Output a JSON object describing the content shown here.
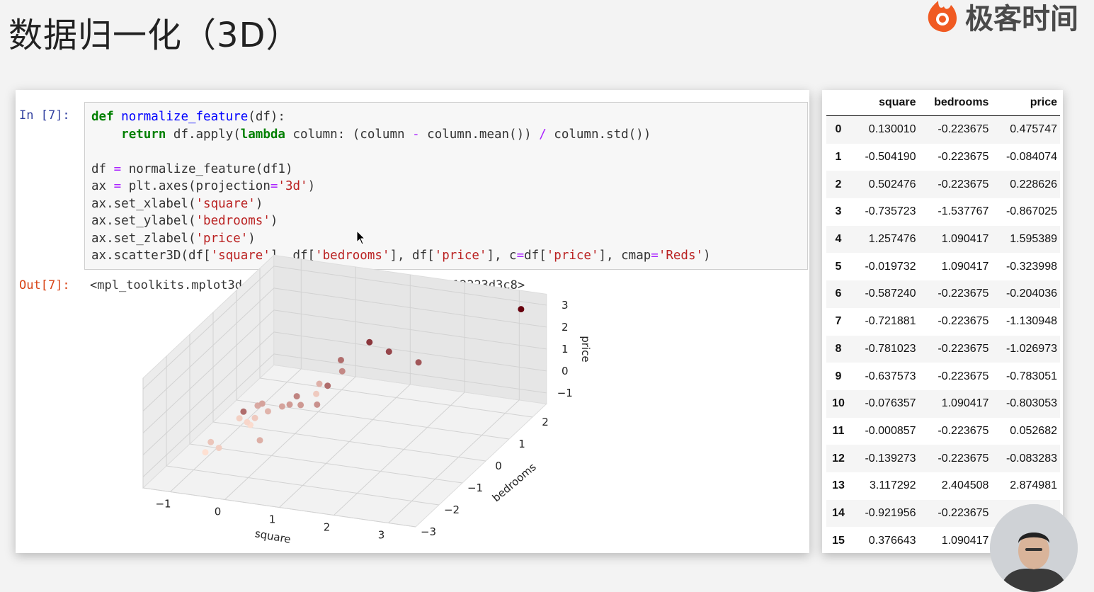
{
  "slide": {
    "title": "数据归一化（3D）",
    "brand": "极客时间",
    "brand_color": "#f05a22"
  },
  "notebook": {
    "in_prompt": "In [7]:",
    "out_prompt": "Out[7]:",
    "code_lines": [
      "def normalize_feature(df):",
      "    return df.apply(lambda column: (column - column.mean()) / column.std())",
      "",
      "df = normalize_feature(df1)",
      "ax = plt.axes(projection='3d')",
      "ax.set_xlabel('square')",
      "ax.set_ylabel('bedrooms')",
      "ax.set_zlabel('price')",
      "ax.scatter3D(df['square'], df['bedrooms'], df['price'], c=df['price'], cmap='Reds')"
    ],
    "output_text": "<mpl_toolkits.mplot3d.art3d.Path3DCollection at 0x12323d3c8>"
  },
  "chart_data": {
    "type": "scatter",
    "projection": "3d",
    "title": "",
    "xlabel": "square",
    "ylabel": "bedrooms",
    "zlabel": "price",
    "xticks": [
      "−1",
      "0",
      "1",
      "2",
      "3"
    ],
    "yticks": [
      "−3",
      "−2",
      "−1",
      "0",
      "1",
      "2"
    ],
    "zticks": [
      "−1",
      "0",
      "1",
      "2",
      "3"
    ],
    "xlim": [
      -1.5,
      3.5
    ],
    "ylim": [
      -3.0,
      2.6
    ],
    "zlim": [
      -1.5,
      3.5
    ],
    "cmap": "Reds",
    "grid": true,
    "points": [
      {
        "x": 0.13001,
        "y": -0.223675,
        "z": 0.475747
      },
      {
        "x": -0.50419,
        "y": -0.223675,
        "z": -0.084074
      },
      {
        "x": 0.502476,
        "y": -0.223675,
        "z": 0.228626
      },
      {
        "x": -0.735723,
        "y": -1.537767,
        "z": -0.867025
      },
      {
        "x": 1.257476,
        "y": 1.090417,
        "z": 1.595389
      },
      {
        "x": -0.019732,
        "y": 1.090417,
        "z": -0.323998
      },
      {
        "x": -0.58724,
        "y": -0.223675,
        "z": -0.204036
      },
      {
        "x": -0.721881,
        "y": -0.223675,
        "z": -1.130948
      },
      {
        "x": -0.781023,
        "y": -0.223675,
        "z": -1.026973
      },
      {
        "x": -0.637573,
        "y": -0.223675,
        "z": -0.783051
      },
      {
        "x": -0.076357,
        "y": 1.090417,
        "z": -0.803053
      },
      {
        "x": -0.000857,
        "y": -0.223675,
        "z": 0.052682
      },
      {
        "x": -0.139273,
        "y": -0.223675,
        "z": -0.083283
      },
      {
        "x": 3.117292,
        "y": 2.404508,
        "z": 2.874981
      },
      {
        "x": -0.921956,
        "y": -0.223675,
        "z": -0.9
      },
      {
        "x": 0.376643,
        "y": 1.090417,
        "z": 0.9
      },
      {
        "x": 1.8,
        "y": 1.09,
        "z": 1.3
      },
      {
        "x": 0.9,
        "y": 1.09,
        "z": 1.9
      },
      {
        "x": 0.6,
        "y": 0.0,
        "z": 0.9
      },
      {
        "x": -0.3,
        "y": -1.5,
        "z": 0.9
      },
      {
        "x": 0.2,
        "y": -0.22,
        "z": 0.1
      },
      {
        "x": -0.4,
        "y": -0.22,
        "z": -0.4
      },
      {
        "x": 0.4,
        "y": 1.09,
        "z": 0.4
      },
      {
        "x": -0.9,
        "y": -1.5,
        "z": -0.7
      },
      {
        "x": -1.0,
        "y": -1.5,
        "z": -1.2
      },
      {
        "x": 0.0,
        "y": -1.5,
        "z": -0.3
      }
    ]
  },
  "dataframe": {
    "columns": [
      "square",
      "bedrooms",
      "price"
    ],
    "rows": [
      {
        "index": "0",
        "square": "0.130010",
        "bedrooms": "-0.223675",
        "price": "0.475747"
      },
      {
        "index": "1",
        "square": "-0.504190",
        "bedrooms": "-0.223675",
        "price": "-0.084074"
      },
      {
        "index": "2",
        "square": "0.502476",
        "bedrooms": "-0.223675",
        "price": "0.228626"
      },
      {
        "index": "3",
        "square": "-0.735723",
        "bedrooms": "-1.537767",
        "price": "-0.867025"
      },
      {
        "index": "4",
        "square": "1.257476",
        "bedrooms": "1.090417",
        "price": "1.595389"
      },
      {
        "index": "5",
        "square": "-0.019732",
        "bedrooms": "1.090417",
        "price": "-0.323998"
      },
      {
        "index": "6",
        "square": "-0.587240",
        "bedrooms": "-0.223675",
        "price": "-0.204036"
      },
      {
        "index": "7",
        "square": "-0.721881",
        "bedrooms": "-0.223675",
        "price": "-1.130948"
      },
      {
        "index": "8",
        "square": "-0.781023",
        "bedrooms": "-0.223675",
        "price": "-1.026973"
      },
      {
        "index": "9",
        "square": "-0.637573",
        "bedrooms": "-0.223675",
        "price": "-0.783051"
      },
      {
        "index": "10",
        "square": "-0.076357",
        "bedrooms": "1.090417",
        "price": "-0.803053"
      },
      {
        "index": "11",
        "square": "-0.000857",
        "bedrooms": "-0.223675",
        "price": "0.052682"
      },
      {
        "index": "12",
        "square": "-0.139273",
        "bedrooms": "-0.223675",
        "price": "-0.083283"
      },
      {
        "index": "13",
        "square": "3.117292",
        "bedrooms": "2.404508",
        "price": "2.874981"
      },
      {
        "index": "14",
        "square": "-0.921956",
        "bedrooms": "-0.223675",
        "price": "-0."
      },
      {
        "index": "15",
        "square": "0.376643",
        "bedrooms": "1.090417",
        "price": ""
      }
    ]
  }
}
